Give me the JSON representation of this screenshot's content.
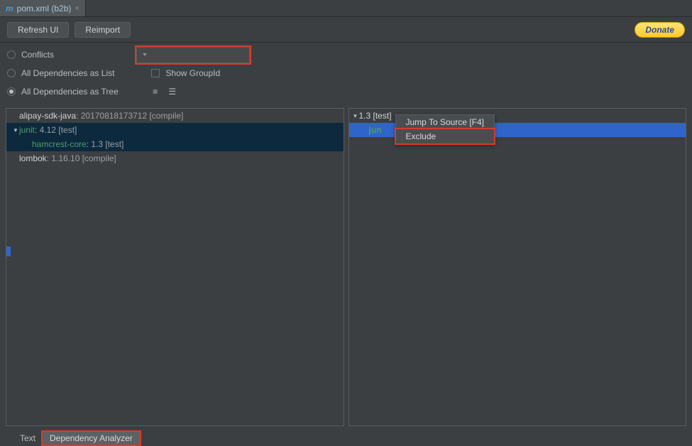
{
  "tab": {
    "icon_letter": "m",
    "label": "pom.xml (b2b)",
    "close_glyph": "×"
  },
  "toolbar": {
    "refresh": "Refresh UI",
    "reimport": "Reimport",
    "donate": "Donate"
  },
  "options": {
    "conflicts": "Conflicts",
    "list": "All Dependencies as List",
    "tree": "All Dependencies as Tree",
    "show_groupid": "Show GroupId",
    "search_placeholder": ""
  },
  "left_tree": {
    "row0": {
      "name": "alipay-sdk-java",
      "meta": " : 20170818173712 [compile]"
    },
    "row1": {
      "name": "junit",
      "meta": " : 4.12 [test]"
    },
    "row2": {
      "name": "hamcrest-core",
      "meta": " : 1.3 [test]"
    },
    "row3": {
      "name": "lombok",
      "meta": " : 1.16.10 [compile]"
    }
  },
  "right_pane": {
    "header": "1.3 [test]",
    "child_prefix": "jun"
  },
  "context_menu": {
    "jump": "Jump To Source [F4]",
    "exclude": "Exclude"
  },
  "bottom_tabs": {
    "text": "Text",
    "analyzer": "Dependency Analyzer"
  }
}
